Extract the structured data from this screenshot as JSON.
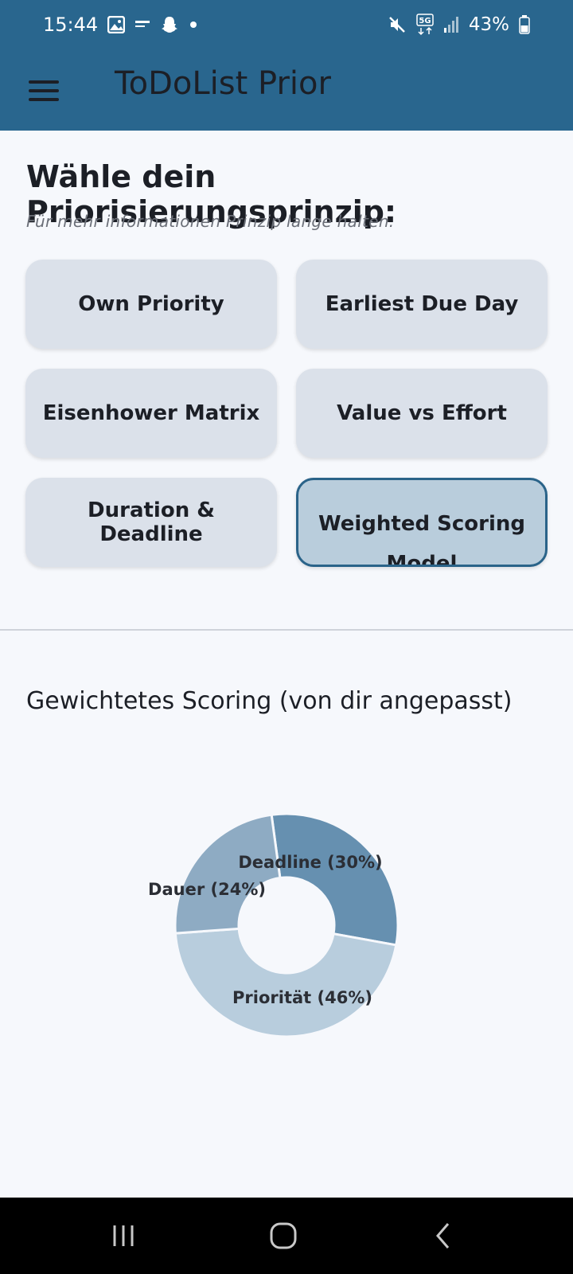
{
  "status_bar": {
    "time": "15:44",
    "battery": "43%",
    "network": "5G"
  },
  "app_bar": {
    "title": "ToDoList Prior"
  },
  "main": {
    "heading": "Wähle dein Priorisierungsprinzip:",
    "subheading": "Für mehr informationen Prinzip lange halten.",
    "principles": [
      {
        "label": "Own Priority",
        "selected": false
      },
      {
        "label": "Earliest Due Day",
        "selected": false
      },
      {
        "label": "Eisenhower Matrix",
        "selected": false
      },
      {
        "label": "Value vs Effort",
        "selected": false
      },
      {
        "label": "Duration & Deadline",
        "selected": false
      },
      {
        "label": "Weighted Scoring Model",
        "selected": true
      }
    ],
    "section_title": "Gewichtetes Scoring (von dir angepasst)"
  },
  "chart_data": {
    "type": "pie",
    "donut": true,
    "slices": [
      {
        "label": "Deadline (30%)",
        "value": 30,
        "color": "#6690b0"
      },
      {
        "label": "Priorität (46%)",
        "value": 46,
        "color": "#b8cddd"
      },
      {
        "label": "Dauer (24%)",
        "value": 24,
        "color": "#8eabc3"
      }
    ]
  },
  "colors": {
    "primary": "#29668e",
    "button_bg": "#dbe1ea",
    "selected_bg": "#b9cddc",
    "background": "#f6f8fc"
  },
  "icons": {
    "status_left": [
      "gallery-icon",
      "app-notification-icon",
      "snapchat-icon",
      "dot-icon"
    ],
    "status_right": [
      "mute-icon",
      "5g-icon",
      "signal-icon",
      "battery-icon"
    ],
    "nav": [
      "recent-apps-icon",
      "home-icon",
      "back-icon"
    ]
  }
}
